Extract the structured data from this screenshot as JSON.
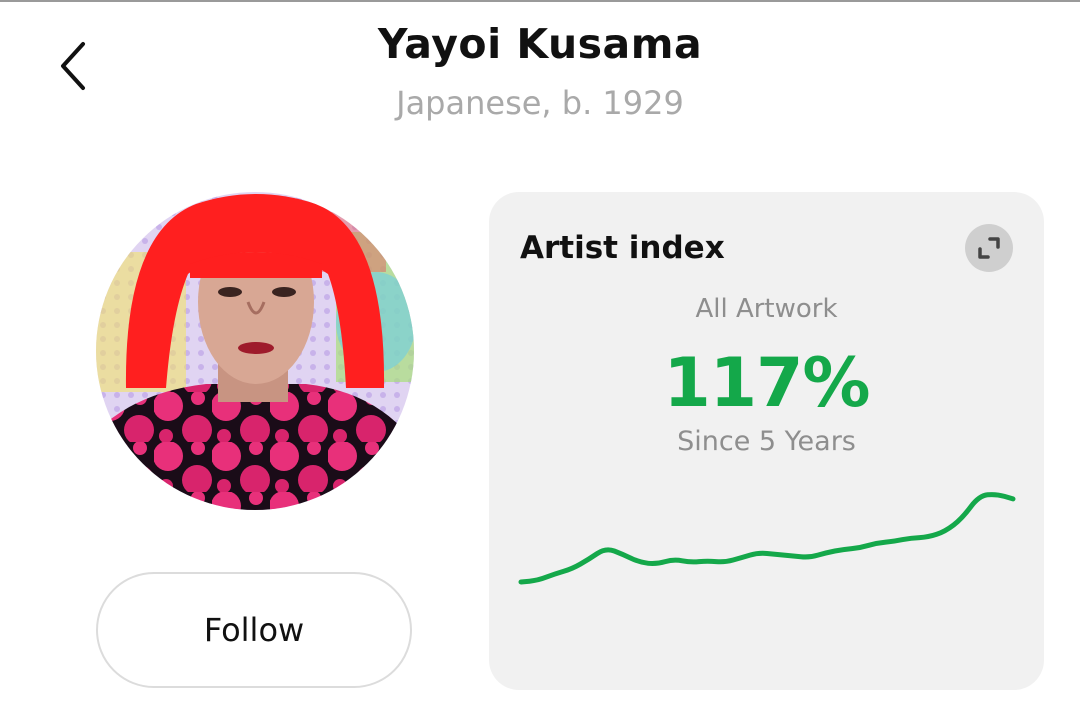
{
  "header": {
    "artist_name": "Yayoi Kusama",
    "artist_meta": "Japanese, b. 1929"
  },
  "profile": {
    "follow_label": "Follow"
  },
  "index_card": {
    "title": "Artist index",
    "category": "All Artwork",
    "value": "117%",
    "period": "Since 5 Years",
    "line_color": "#14a84a",
    "trend": [
      10,
      12,
      20,
      26,
      38,
      52,
      44,
      34,
      32,
      38,
      34,
      36,
      34,
      40,
      46,
      44,
      42,
      40,
      46,
      50,
      52,
      58,
      60,
      64,
      65,
      72,
      88,
      116,
      118,
      112
    ]
  },
  "icons": {
    "back": "chevron-left-icon",
    "expand": "expand-icon"
  },
  "colors": {
    "accent_green": "#14a84a",
    "muted_text": "#a9a9a9",
    "card_bg": "#f1f1f1"
  }
}
